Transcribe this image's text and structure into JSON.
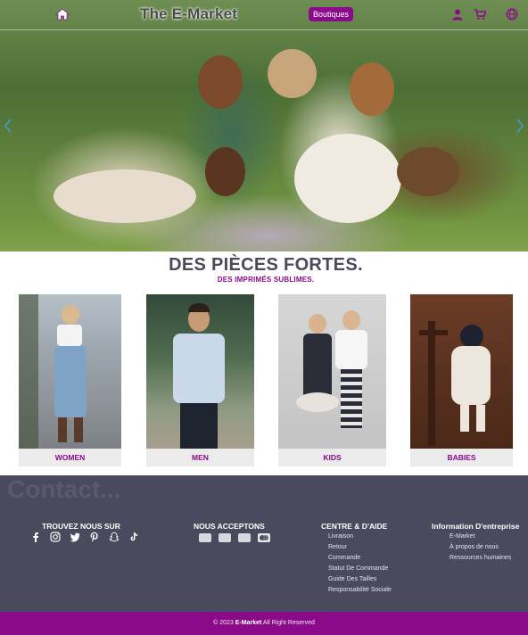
{
  "nav": {
    "brand": "The E-Market",
    "boutiques_label": "Boutiques",
    "icons": [
      "home-icon",
      "user-icon",
      "cart-icon",
      "globe-icon"
    ]
  },
  "hero": {
    "prev_icon": "chevron-left-icon",
    "next_icon": "chevron-right-icon"
  },
  "section": {
    "title": "DES PIÈCES FORTES.",
    "subtitle": "DES IMPRIMÉS SUBLIMES."
  },
  "categories": [
    {
      "label": "WOMEN"
    },
    {
      "label": "MEN"
    },
    {
      "label": "KIDS"
    },
    {
      "label": "BABIES"
    }
  ],
  "footer": {
    "watermark": "Contact...",
    "follow_title": "TROUVEZ NOUS SUR",
    "social_icons": [
      "facebook-icon",
      "instagram-icon",
      "twitter-icon",
      "pinterest-icon",
      "snapchat-icon",
      "tiktok-icon"
    ],
    "accept_title": "NOUS ACCEPTONS",
    "payment_icons": [
      "paypal-icon",
      "visa-icon",
      "amex-icon",
      "mastercard-icon"
    ],
    "help_title": "CENTRE & D'AIDE",
    "help_links": [
      "Livraison",
      "Retour",
      "Commande",
      "Statut De Commande",
      "Guide Des Tailles",
      "Responsabilité Sociale"
    ],
    "info_title": "Information D'entreprise",
    "info_links": [
      "E-Market",
      "À propos de nous",
      "Ressources humaines"
    ]
  },
  "bottom": {
    "prefix": "© 2023 ",
    "brand": "E-Market",
    "suffix": " All Right Reserved"
  },
  "colors": {
    "accent": "#8a0a8a",
    "footer_bg": "#4a4a5e"
  }
}
